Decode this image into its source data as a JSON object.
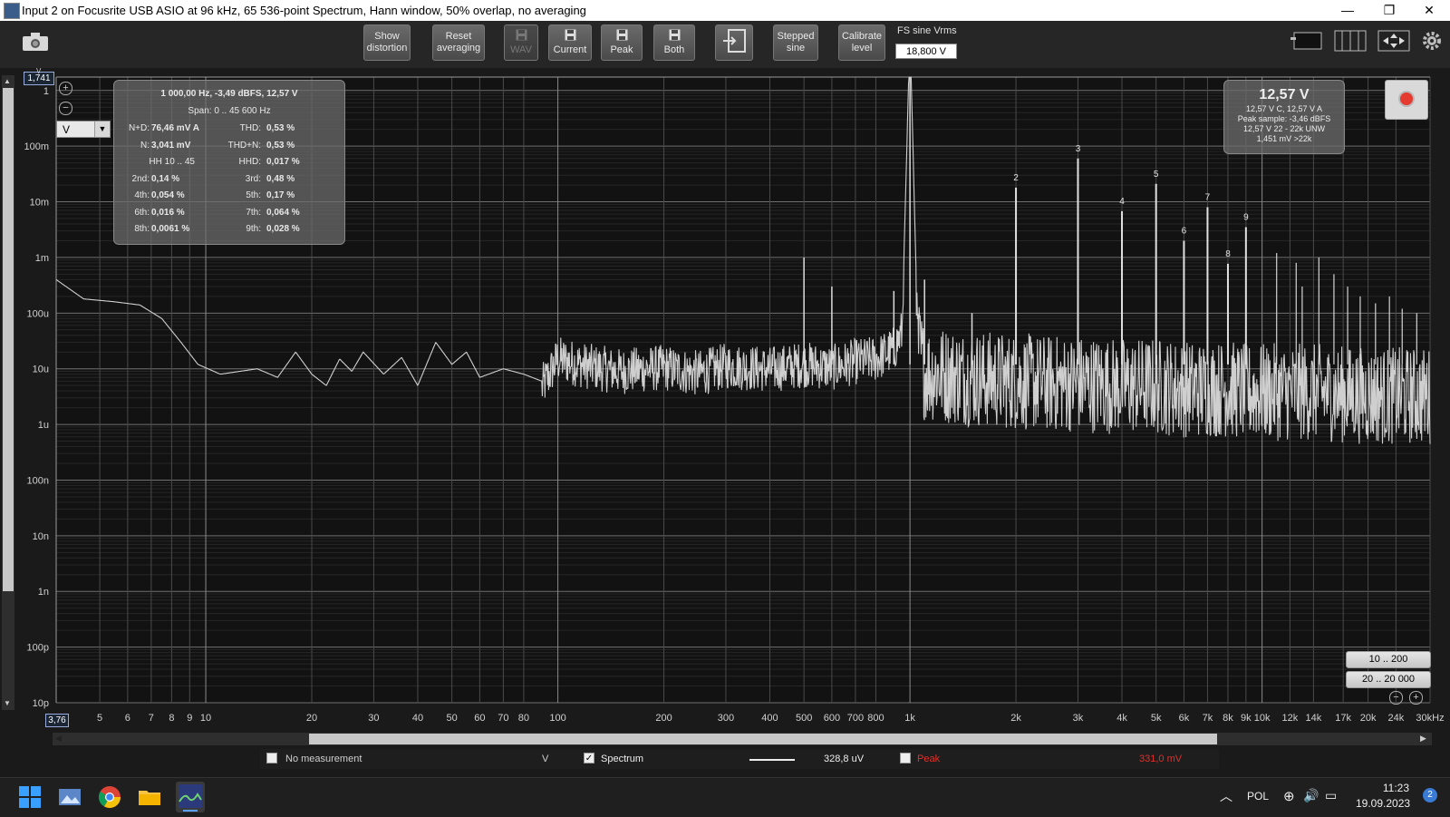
{
  "window": {
    "title": "Input 2 on Focusrite USB ASIO at 96 kHz, 65 536-point Spectrum, Hann window, 50% overlap, no averaging"
  },
  "toolbar": {
    "buttons": [
      {
        "id": "show-distortion",
        "lines": [
          "Show",
          "distortion"
        ],
        "x": 401,
        "w": 52,
        "disabled": false
      },
      {
        "id": "reset-averaging",
        "lines": [
          "Reset",
          "averaging"
        ],
        "x": 477,
        "w": 58,
        "disabled": false
      },
      {
        "id": "save-wav",
        "lines": [
          "WAV"
        ],
        "x": 556,
        "w": 38,
        "disabled": true,
        "icon": true
      },
      {
        "id": "save-current",
        "lines": [
          "Current"
        ],
        "x": 605,
        "w": 48,
        "disabled": false,
        "icon": true
      },
      {
        "id": "save-peak",
        "lines": [
          "Peak"
        ],
        "x": 663,
        "w": 46,
        "disabled": false,
        "icon": true
      },
      {
        "id": "save-both",
        "lines": [
          "Both"
        ],
        "x": 721,
        "w": 46,
        "disabled": false,
        "icon": true
      },
      {
        "id": "generator",
        "lines": [
          ""
        ],
        "x": 789,
        "w": 42,
        "disabled": false,
        "icon": true
      },
      {
        "id": "stepped-sine",
        "lines": [
          "Stepped",
          "sine"
        ],
        "x": 853,
        "w": 50,
        "disabled": false
      },
      {
        "id": "calibrate-level",
        "lines": [
          "Calibrate",
          "level"
        ],
        "x": 925,
        "w": 52,
        "disabled": false
      }
    ],
    "fs_label": "FS sine Vrms",
    "fs_value": "18,800 V"
  },
  "readout": {
    "header": "1 000,00 Hz, -3,49 dBFS, 12,57 V",
    "span": "Span: 0 .. 45 600 Hz",
    "rows": [
      [
        "N+D:",
        "76,46 mV A",
        "THD:",
        "0,53 %"
      ],
      [
        "N:",
        "3,041 mV",
        "THD+N:",
        "0,53 %"
      ],
      [
        "HH 10 .. 45",
        "",
        "HHD:",
        "0,017 %"
      ],
      [
        "2nd:",
        "0,14 %",
        "3rd:",
        "0,48 %"
      ],
      [
        "4th:",
        "0,054 %",
        "5th:",
        "0,17 %"
      ],
      [
        "6th:",
        "0,016 %",
        "7th:",
        "0,064 %"
      ],
      [
        "8th:",
        "0,0061 %",
        "9th:",
        "0,028 %"
      ]
    ]
  },
  "level_box": {
    "big": "12,57 V",
    "lines": [
      "12,57 V C, 12,57 V A",
      "Peak sample: -3,46 dBFS",
      "12,57 V 22 - 22k UNW",
      "1,451 mV >22k"
    ]
  },
  "unit_select": "V",
  "y_unit": "V",
  "y_top_value": "1,741",
  "x_start_value": "3,76",
  "range_buttons": [
    "10 .. 200",
    "20 .. 20 000"
  ],
  "legend": {
    "no_measurement": "No measurement",
    "unit": "V",
    "spectrum": "Spectrum",
    "spectrum_value": "328,8 uV",
    "peak": "Peak",
    "peak_value": "331,0 mV",
    "peak_color": "#e0302a"
  },
  "taskbar": {
    "lang": "POL",
    "time": "11:23",
    "date": "19.09.2023",
    "badge": "2"
  },
  "chart_data": {
    "type": "line",
    "x_scale": "log",
    "y_scale": "log",
    "xlim": [
      3.76,
      30000
    ],
    "ylim": [
      1e-11,
      1.741
    ],
    "y_ticks": [
      {
        "v": 1,
        "label": "1"
      },
      {
        "v": 0.1,
        "label": "100m"
      },
      {
        "v": 0.01,
        "label": "10m"
      },
      {
        "v": 0.001,
        "label": "1m"
      },
      {
        "v": 0.0001,
        "label": "100u"
      },
      {
        "v": 1e-05,
        "label": "10u"
      },
      {
        "v": 1e-06,
        "label": "1u"
      },
      {
        "v": 1e-07,
        "label": "100n"
      },
      {
        "v": 1e-08,
        "label": "10n"
      },
      {
        "v": 1e-09,
        "label": "1n"
      },
      {
        "v": 1e-10,
        "label": "100p"
      },
      {
        "v": 1e-11,
        "label": "10p"
      }
    ],
    "x_ticks": [
      {
        "v": 5,
        "label": "5"
      },
      {
        "v": 6,
        "label": "6"
      },
      {
        "v": 7,
        "label": "7"
      },
      {
        "v": 8,
        "label": "8"
      },
      {
        "v": 9,
        "label": "9"
      },
      {
        "v": 10,
        "label": "10"
      },
      {
        "v": 20,
        "label": "20"
      },
      {
        "v": 30,
        "label": "30"
      },
      {
        "v": 40,
        "label": "40"
      },
      {
        "v": 50,
        "label": "50"
      },
      {
        "v": 60,
        "label": "60"
      },
      {
        "v": 70,
        "label": "70"
      },
      {
        "v": 80,
        "label": "80"
      },
      {
        "v": 100,
        "label": "100"
      },
      {
        "v": 200,
        "label": "200"
      },
      {
        "v": 300,
        "label": "300"
      },
      {
        "v": 400,
        "label": "400"
      },
      {
        "v": 500,
        "label": "500"
      },
      {
        "v": 600,
        "label": "600"
      },
      {
        "v": 700,
        "label": "700"
      },
      {
        "v": 800,
        "label": "800"
      },
      {
        "v": 1000,
        "label": "1k"
      },
      {
        "v": 2000,
        "label": "2k"
      },
      {
        "v": 3000,
        "label": "3k"
      },
      {
        "v": 4000,
        "label": "4k"
      },
      {
        "v": 5000,
        "label": "5k"
      },
      {
        "v": 6000,
        "label": "6k"
      },
      {
        "v": 7000,
        "label": "7k"
      },
      {
        "v": 8000,
        "label": "8k"
      },
      {
        "v": 9000,
        "label": "9k"
      },
      {
        "v": 10000,
        "label": "10k"
      },
      {
        "v": 12000,
        "label": "12k"
      },
      {
        "v": 14000,
        "label": "14k"
      },
      {
        "v": 17000,
        "label": "17k"
      },
      {
        "v": 20000,
        "label": "20k"
      },
      {
        "v": 24000,
        "label": "24k"
      },
      {
        "v": 30000,
        "label": "30kHz"
      }
    ],
    "series": [
      {
        "name": "Spectrum",
        "x": [
          3.76,
          4.5,
          5.5,
          6.5,
          7.5,
          8.5,
          9.5,
          11,
          12.5,
          14,
          16,
          18,
          20,
          22,
          24,
          26,
          28,
          32,
          36,
          40,
          45,
          50,
          55,
          60,
          70,
          80,
          90,
          100,
          120,
          150,
          200,
          250,
          300,
          400,
          500,
          600,
          700,
          800,
          900,
          950,
          1000,
          1050,
          1100,
          1300,
          1600,
          2000,
          2500,
          3000,
          4000,
          5000,
          6000,
          7000,
          8000,
          9000,
          10000,
          14000,
          20000,
          30000
        ],
        "y": [
          0.0004,
          0.00018,
          0.00016,
          0.00014,
          8e-05,
          3e-05,
          1.2e-05,
          8e-06,
          9e-06,
          1e-05,
          7e-06,
          2e-05,
          8e-06,
          5e-06,
          1.5e-05,
          9e-06,
          2e-05,
          8e-06,
          1.6e-05,
          5e-06,
          3e-05,
          1.2e-05,
          2e-05,
          7e-06,
          1e-05,
          8e-06,
          6e-06,
          2e-05,
          1.5e-05,
          1.2e-05,
          1.4e-05,
          1.1e-05,
          1.5e-05,
          1.3e-05,
          1.6e-05,
          1.4e-05,
          1.8e-05,
          2e-05,
          3e-05,
          6e-05,
          12.57,
          6e-05,
          1.6e-05,
          1.4e-05,
          1.2e-05,
          1.1e-05,
          1e-05,
          1e-05,
          9e-06,
          9e-06,
          8e-06,
          8e-06,
          8e-06,
          7e-06,
          7e-06,
          7e-06,
          6e-06,
          6e-06
        ]
      }
    ],
    "peaks": [
      {
        "x": 500,
        "y": 0.001
      },
      {
        "x": 600,
        "y": 0.0003
      },
      {
        "x": 900,
        "y": 0.00025
      },
      {
        "x": 1000,
        "y": 12.57
      },
      {
        "x": 1100,
        "y": 0.0004
      },
      {
        "x": 1500,
        "y": 0.0001
      }
    ],
    "harmonics": [
      {
        "n": "2",
        "x": 2000,
        "y": 0.018
      },
      {
        "n": "3",
        "x": 3000,
        "y": 0.06
      },
      {
        "n": "4",
        "x": 4000,
        "y": 0.0068
      },
      {
        "n": "5",
        "x": 5000,
        "y": 0.021
      },
      {
        "n": "6",
        "x": 6000,
        "y": 0.002
      },
      {
        "n": "7",
        "x": 7000,
        "y": 0.008
      },
      {
        "n": "8",
        "x": 8000,
        "y": 0.00077
      },
      {
        "n": "9",
        "x": 9000,
        "y": 0.0035
      }
    ]
  }
}
